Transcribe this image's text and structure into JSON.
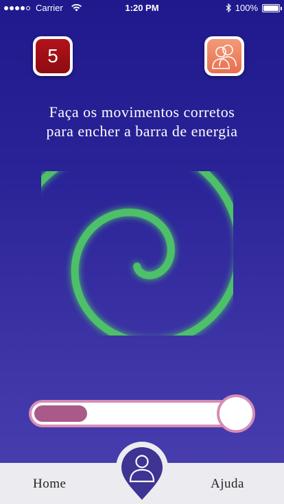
{
  "status_bar": {
    "carrier": "Carrier",
    "time": "1:20 PM",
    "battery": "100%"
  },
  "header": {
    "level": "5"
  },
  "instruction": "Faça os movimentos   corretos\npara encher a barra de energia",
  "energy": {
    "fill_fraction": 0.27
  },
  "tabs": {
    "home": "Home",
    "help": "Ajuda"
  },
  "colors": {
    "background": "#20198e",
    "spiral": "#4ec06a",
    "level_badge": "#a80f17",
    "users_button": "#ee8563",
    "energy_fill": "#aa5a88",
    "energy_border": "#d58db5",
    "profile_pin": "#3e3493"
  },
  "icons": {
    "users": "users-icon",
    "profile": "user-profile-icon",
    "gesture": "spiral-gesture-icon"
  }
}
